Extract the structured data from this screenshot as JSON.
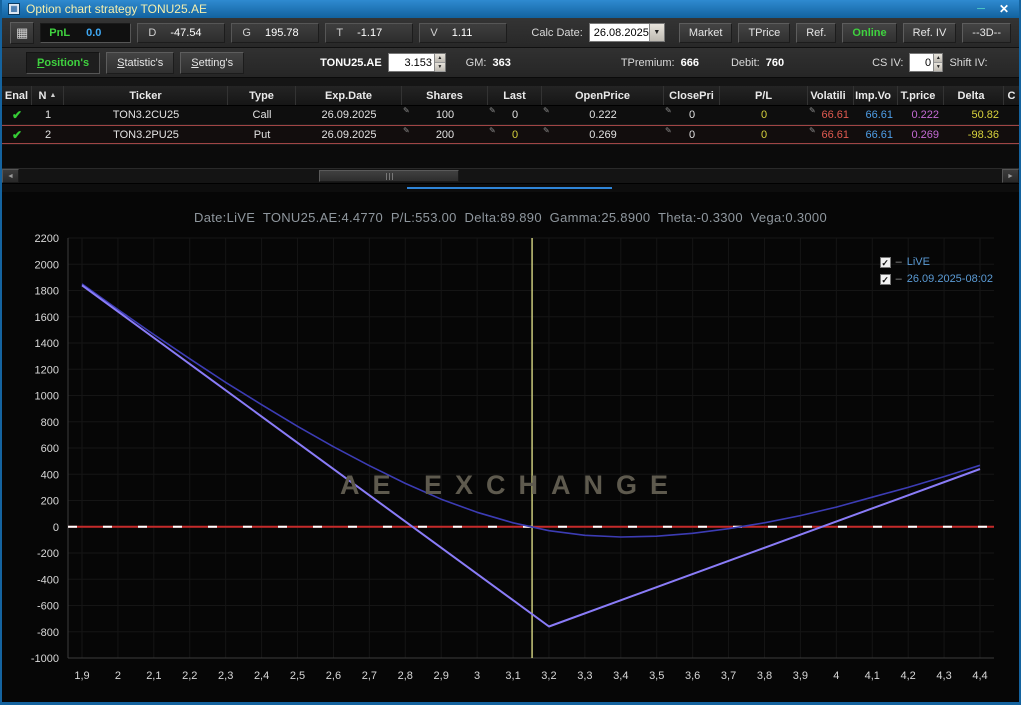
{
  "window": {
    "title": "Option chart strategy TONU25.AE",
    "minimize_glyph": "─",
    "close_glyph": "✕"
  },
  "colors": {
    "titlebar": "#12629f",
    "accent_green": "#3fd23f",
    "value_blue": "#3fa9f5",
    "cell_red": "#e05a50",
    "cell_blue": "#4f9fe8",
    "cell_magenta": "#c46ad4",
    "cell_yellow": "#d8d23c",
    "legend_text": "#5b9bd5"
  },
  "toolbar1": {
    "grid_button_glyph": "▦",
    "pnl_label": "PnL",
    "pnl_value": "0.0",
    "greeks": [
      {
        "label": "D",
        "value": "-47.54"
      },
      {
        "label": "G",
        "value": "195.78"
      },
      {
        "label": "T",
        "value": "-1.17"
      },
      {
        "label": "V",
        "value": "1.11"
      }
    ],
    "calc_date_label": "Calc Date:",
    "calc_date_value": "26.08.2025",
    "market": "Market",
    "tprice": "TPrice",
    "ref": "Ref.",
    "online": "Online",
    "ref_iv": "Ref. IV",
    "threed": "--3D--"
  },
  "toolbar2": {
    "tabs": [
      {
        "m": "P",
        "rest": "osition's"
      },
      {
        "m": "S",
        "rest": "tatistic's"
      },
      {
        "m": "S",
        "rest": "etting's"
      }
    ],
    "symbol": "TONU25.AE",
    "price_value": "3.153",
    "gm_label": "GM:",
    "gm_value": "363",
    "tpremium_label": "TPremium:",
    "tpremium_value": "666",
    "debit_label": "Debit:",
    "debit_value": "760",
    "csiv_label": "CS IV:",
    "csiv_value": "0",
    "shiftiv_label": "Shift IV:"
  },
  "table": {
    "headers": [
      "Enal",
      "N",
      "Ticker",
      "Type",
      "Exp.Date",
      "Shares",
      "Last",
      "OpenPrice",
      "ClosePri",
      "P/L",
      "Volatili",
      "Imp.Vo",
      "T.price",
      "Delta",
      "C"
    ],
    "rows": [
      {
        "n": "1",
        "ticker": "TON3.2CU25",
        "type": "Call",
        "exp": "26.09.2025",
        "shares": "100",
        "last": "0",
        "open": "0.222",
        "close": "0",
        "pl": "0",
        "vol": "66.61",
        "impvol": "66.61",
        "tprice": "0.222",
        "delta": "50.82"
      },
      {
        "n": "2",
        "ticker": "TON3.2PU25",
        "type": "Put",
        "exp": "26.09.2025",
        "shares": "200",
        "last": "0",
        "open": "0.269",
        "close": "0",
        "pl": "0",
        "vol": "66.61",
        "impvol": "66.61",
        "tprice": "0.269",
        "delta": "-98.36"
      }
    ]
  },
  "chart_data": {
    "type": "line",
    "title": "Date:LiVE  TONU25.AE:4.4770  P/L:553.00  Delta:89.890  Gamma:25.8900  Theta:-0.3300  Vega:0.3000",
    "watermark": "AE EXCHANGE",
    "xlabel": "",
    "ylabel": "",
    "xlim": [
      1.9,
      4.4
    ],
    "ylim": [
      -1000,
      2200
    ],
    "grid": true,
    "legend_position": "top-right",
    "x_ticks": [
      "1,9",
      "2",
      "2,1",
      "2,2",
      "2,3",
      "2,4",
      "2,5",
      "2,6",
      "2,7",
      "2,8",
      "2,9",
      "3",
      "3,1",
      "3,2",
      "3,3",
      "3,4",
      "3,5",
      "3,6",
      "3,7",
      "3,8",
      "3,9",
      "4",
      "4,1",
      "4,2",
      "4,3",
      "4,4"
    ],
    "x_tick_values": [
      1.9,
      2.0,
      2.1,
      2.2,
      2.3,
      2.4,
      2.5,
      2.6,
      2.7,
      2.8,
      2.9,
      3.0,
      3.1,
      3.2,
      3.3,
      3.4,
      3.5,
      3.6,
      3.7,
      3.8,
      3.9,
      4.0,
      4.1,
      4.2,
      4.3,
      4.4
    ],
    "y_ticks": [
      2200,
      2000,
      1800,
      1600,
      1400,
      1200,
      1000,
      800,
      600,
      400,
      200,
      0,
      -200,
      -400,
      -600,
      -800,
      -1000
    ],
    "zero_line": {
      "y": 0,
      "color": "#c52b2b"
    },
    "vertical_line": {
      "x": 3.153,
      "color": "#c9c97c"
    },
    "legend": [
      {
        "label": "LiVE"
      },
      {
        "label": "26.09.2025-08:02"
      }
    ],
    "series": [
      {
        "name": "LiVE",
        "color": "#3c3cb4",
        "width": 1.6,
        "x": [
          1.9,
          2.0,
          2.1,
          2.2,
          2.3,
          2.4,
          2.5,
          2.6,
          2.7,
          2.8,
          2.9,
          3.0,
          3.1,
          3.2,
          3.3,
          3.4,
          3.5,
          3.6,
          3.7,
          3.8,
          3.9,
          4.0,
          4.1,
          4.2,
          4.3,
          4.4
        ],
        "y": [
          1850,
          1655,
          1465,
          1280,
          1100,
          930,
          765,
          610,
          465,
          330,
          210,
          110,
          30,
          -30,
          -65,
          -78,
          -72,
          -50,
          -15,
          30,
          85,
          150,
          225,
          300,
          382,
          468
        ]
      },
      {
        "name": "26.09.2025-08:02",
        "color": "#8a7cf8",
        "width": 2,
        "x": [
          1.9,
          3.2,
          4.4
        ],
        "y": [
          1840,
          -760,
          440
        ]
      }
    ]
  }
}
